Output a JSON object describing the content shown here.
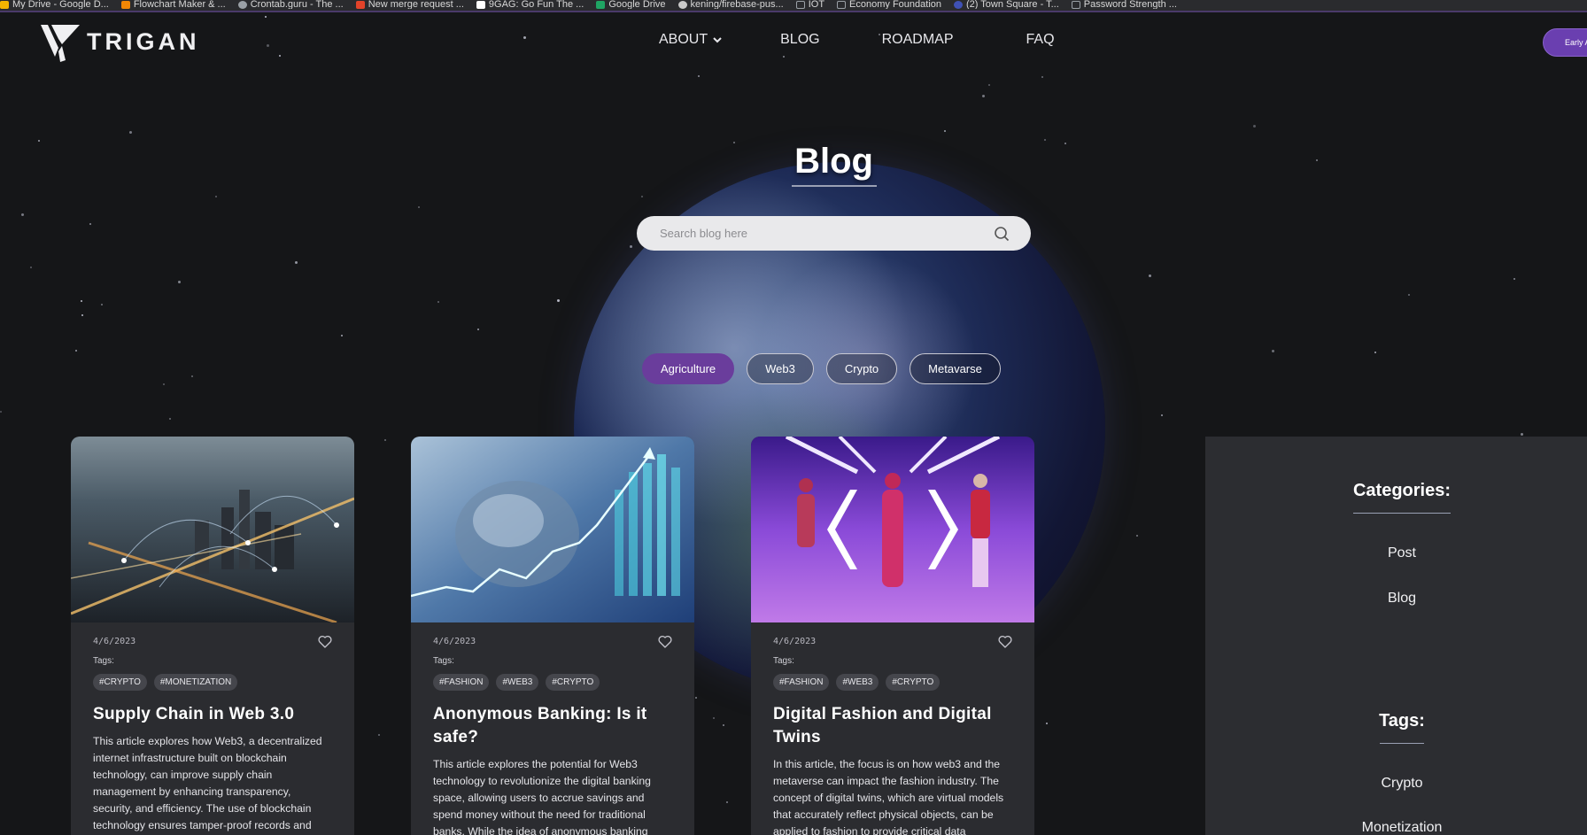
{
  "bookmarks": [
    {
      "label": "My Drive - Google D...",
      "color": "#f4b400"
    },
    {
      "label": "Flowchart Maker & ...",
      "color": "#f08705"
    },
    {
      "label": "Crontab.guru - The ...",
      "color": "#9aa0a6"
    },
    {
      "label": "New merge request ...",
      "color": "#e24329"
    },
    {
      "label": "9GAG: Go Fun The ...",
      "color": "#ffffff"
    },
    {
      "label": "Google Drive",
      "color": "#1fa463"
    },
    {
      "label": "kening/firebase-pus...",
      "color": "#c9c9c9"
    },
    {
      "label": "IOT",
      "color": "#9aa0a6"
    },
    {
      "label": "Economy Foundation",
      "color": "#9aa0a6"
    },
    {
      "label": "(2) Town Square - T...",
      "color": "#3f51b5"
    },
    {
      "label": "Password Strength ...",
      "color": "#9aa0a6"
    }
  ],
  "header": {
    "logo_text": "TRIGAN",
    "nav": {
      "about": "ABOUT",
      "blog": "BLOG",
      "roadmap": "ROADMAP",
      "faq": "FAQ"
    },
    "cta_label": "Early A"
  },
  "hero": {
    "title": "Blog",
    "search_placeholder": "Search blog here"
  },
  "filters": [
    {
      "label": "Agriculture",
      "active": true
    },
    {
      "label": "Web3",
      "active": false
    },
    {
      "label": "Crypto",
      "active": false
    },
    {
      "label": "Metavarse",
      "active": false
    }
  ],
  "posts": [
    {
      "date": "4/6/2023",
      "tags_label": "Tags:",
      "tags": [
        "#CRYPTO",
        "#MONETIZATION"
      ],
      "title": "Supply Chain in Web 3.0",
      "description": "This article explores how Web3, a decentralized internet infrastructure built on blockchain technology, can improve supply chain management by enhancing transparency, security, and efficiency. The use of blockchain technology ensures tamper-proof records and"
    },
    {
      "date": "4/6/2023",
      "tags_label": "Tags:",
      "tags": [
        "#FASHION",
        "#WEB3",
        "#CRYPTO"
      ],
      "title": "Anonymous Banking: Is it safe?",
      "description": "This article explores the potential for Web3 technology to revolutionize the digital banking space, allowing users to accrue savings and spend money without the need for traditional banks. While the idea of anonymous banking"
    },
    {
      "date": "4/6/2023",
      "tags_label": "Tags:",
      "tags": [
        "#FASHION",
        "#WEB3",
        "#CRYPTO"
      ],
      "title": "Digital Fashion and Digital Twins",
      "description": "In this article, the focus is on how web3 and the metaverse can impact the fashion industry. The concept of digital twins, which are virtual models that accurately reflect physical objects, can be applied to fashion to provide critical data"
    }
  ],
  "sidebar": {
    "categories_heading": "Categories:",
    "categories": [
      "Post",
      "Blog"
    ],
    "tags_heading": "Tags:",
    "tags": [
      "Crypto",
      "Monetization"
    ]
  },
  "colors": {
    "accent": "#6a3d9c",
    "background": "#151618",
    "card": "#2b2c30"
  }
}
